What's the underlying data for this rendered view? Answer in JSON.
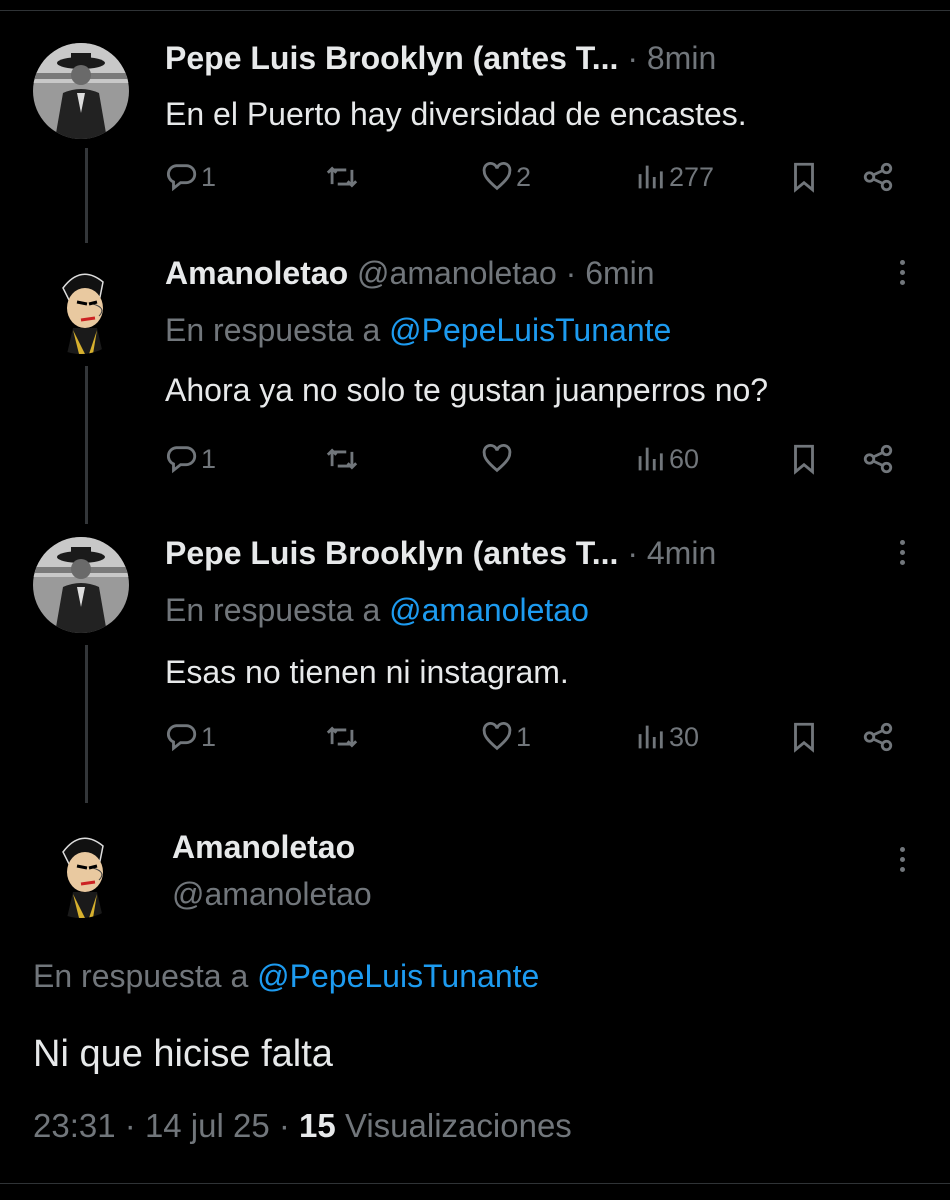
{
  "tweets": [
    {
      "author": "Pepe Luis Brooklyn (antes T...",
      "handle": "",
      "time": "· 8min",
      "reply_prefix": "",
      "reply_to": "",
      "text": "En el Puerto hay diversidad de encastes.",
      "replies": "1",
      "retweets": "",
      "likes": "2",
      "views": "277",
      "avatar": "photo-avatar"
    },
    {
      "author": "Amanoletao",
      "handle": "@amanoletao",
      "time": "· 6min",
      "reply_prefix": "En respuesta a",
      "reply_to": "@PepeLuisTunante",
      "text": "Ahora ya no solo te gustan juanperros no?",
      "replies": "1",
      "retweets": "",
      "likes": "",
      "views": "60",
      "avatar": "cartoon-avatar"
    },
    {
      "author": "Pepe Luis Brooklyn (antes T...",
      "handle": "",
      "time": "· 4min",
      "reply_prefix": "En respuesta a",
      "reply_to": "@amanoletao",
      "text": "Esas no tienen ni instagram.",
      "replies": "1",
      "retweets": "",
      "likes": "1",
      "views": "30",
      "avatar": "photo-avatar"
    }
  ],
  "main": {
    "author": "Amanoletao",
    "handle": "@amanoletao",
    "reply_prefix": "En respuesta a",
    "reply_to": "@PepeLuisTunante",
    "text": "Ni que hicise falta",
    "time": "23:31",
    "date": "14 jul 25",
    "views_count": "15",
    "views_label": "Visualizaciones",
    "sep": "·"
  },
  "colors": {
    "background": "#000000",
    "text": "#e7e9ea",
    "muted": "#71767b",
    "link": "#1d9bf0"
  },
  "icons": [
    "reply-icon",
    "retweet-icon",
    "like-icon",
    "views-icon",
    "bookmark-icon",
    "share-icon",
    "more-icon"
  ]
}
